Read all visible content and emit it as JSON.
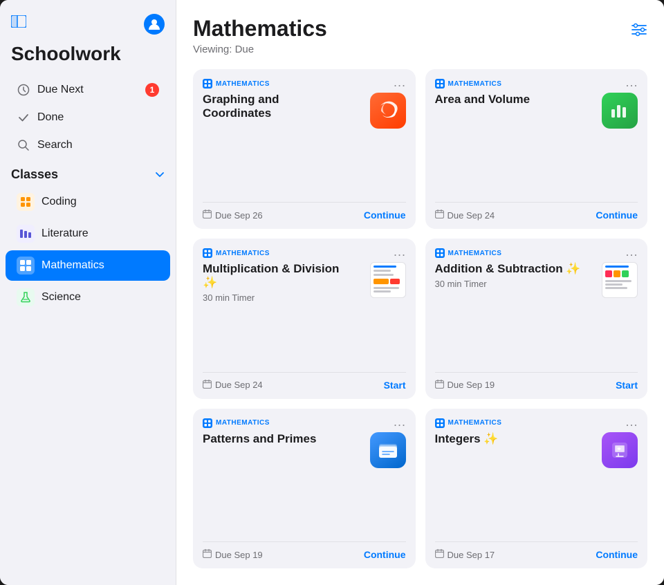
{
  "app": {
    "title": "Schoolwork",
    "toggle_label": "⊞",
    "profile_initial": "👤"
  },
  "sidebar": {
    "nav_items": [
      {
        "id": "due-next",
        "label": "Due Next",
        "icon": "clock",
        "badge": "1"
      },
      {
        "id": "done",
        "label": "Done",
        "icon": "checkmark",
        "badge": null
      },
      {
        "id": "search",
        "label": "Search",
        "icon": "search",
        "badge": null
      }
    ],
    "classes_section": "Classes",
    "classes": [
      {
        "id": "coding",
        "label": "Coding",
        "color": "#ff6b35",
        "icon": "grid"
      },
      {
        "id": "literature",
        "label": "Literature",
        "color": "#5856d6",
        "icon": "chart"
      },
      {
        "id": "mathematics",
        "label": "Mathematics",
        "color": "#007aff",
        "icon": "grid",
        "active": true
      },
      {
        "id": "science",
        "label": "Science",
        "color": "#30d158",
        "icon": "leaf"
      }
    ]
  },
  "main": {
    "title": "Mathematics",
    "viewing_label": "Viewing: Due",
    "filter_icon": "filter"
  },
  "cards": [
    {
      "id": "card-1",
      "category": "MATHEMATICS",
      "title": "Graphing and Coordinates",
      "subtitle": "",
      "app_icon": "swift",
      "due": "Due Sep 26",
      "action": "Continue",
      "action_type": "continue"
    },
    {
      "id": "card-2",
      "category": "MATHEMATICS",
      "title": "Area and Volume",
      "subtitle": "",
      "app_icon": "numbers",
      "due": "Due Sep 24",
      "action": "Continue",
      "action_type": "continue"
    },
    {
      "id": "card-3",
      "category": "MATHEMATICS",
      "title": "Multiplication & Division ✨",
      "subtitle": "30 min Timer",
      "app_icon": "worksheet1",
      "due": "Due Sep 24",
      "action": "Start",
      "action_type": "start"
    },
    {
      "id": "card-4",
      "category": "MATHEMATICS",
      "title": "Addition & Subtraction ✨",
      "subtitle": "30 min Timer",
      "app_icon": "worksheet2",
      "due": "Due Sep 19",
      "action": "Start",
      "action_type": "start"
    },
    {
      "id": "card-5",
      "category": "MATHEMATICS",
      "title": "Patterns and Primes",
      "subtitle": "",
      "app_icon": "files",
      "due": "Due Sep 19",
      "action": "Continue",
      "action_type": "continue"
    },
    {
      "id": "card-6",
      "category": "MATHEMATICS",
      "title": "Integers ✨",
      "subtitle": "",
      "app_icon": "keynote",
      "due": "Due Sep 17",
      "action": "Continue",
      "action_type": "continue"
    }
  ]
}
